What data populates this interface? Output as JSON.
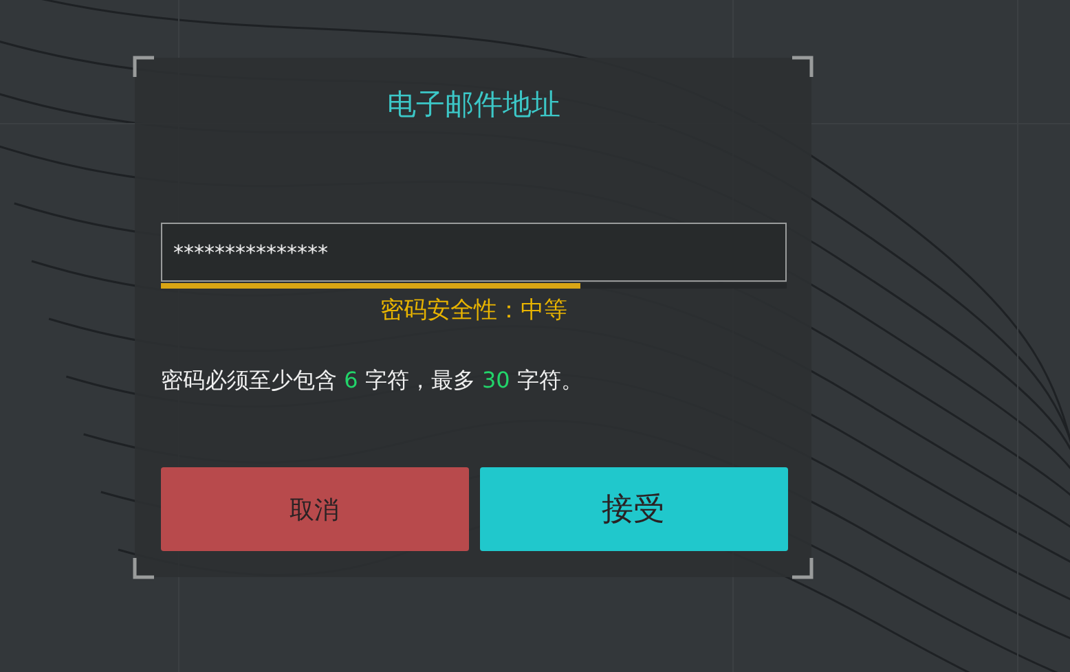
{
  "dialog": {
    "title": "电子邮件地址",
    "password_field": {
      "value": "***************"
    },
    "strength": {
      "level": 0.67,
      "label": "密码安全性：中等"
    },
    "rule": [
      {
        "kind": "plain",
        "text": "密码必须至少包含 "
      },
      {
        "kind": "number",
        "text": "6"
      },
      {
        "kind": "plain",
        "text": " 字符，最多 "
      },
      {
        "kind": "number",
        "text": "30"
      },
      {
        "kind": "plain",
        "text": " 字符。"
      }
    ],
    "buttons": [
      {
        "kind": "cancel",
        "label": "取消"
      },
      {
        "kind": "accept",
        "label": "接受"
      }
    ]
  }
}
